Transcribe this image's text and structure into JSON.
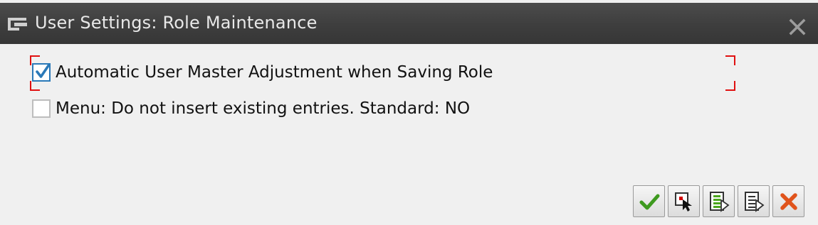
{
  "window": {
    "title": "User Settings: Role Maintenance",
    "icon": "dialog-window-icon",
    "close_icon": "close-icon"
  },
  "options": [
    {
      "label": "Automatic User Master Adjustment when Saving Role",
      "checked": true,
      "focused": true
    },
    {
      "label": "Menu: Do not insert existing entries. Standard: NO",
      "checked": false,
      "focused": false
    }
  ],
  "toolbar": {
    "buttons": [
      {
        "icon": "checkmark-icon",
        "action": "continue"
      },
      {
        "icon": "select-pointer-icon",
        "action": "choose"
      },
      {
        "icon": "select-all-icon",
        "action": "select-all"
      },
      {
        "icon": "deselect-all-icon",
        "action": "deselect-all"
      },
      {
        "icon": "cancel-icon",
        "action": "cancel"
      }
    ]
  },
  "colors": {
    "titlebar": "#3e3e3e",
    "background": "#f0f0f0",
    "focus": "#e01010",
    "check": "#2a79b8",
    "confirm": "#3e9a1f",
    "cancel": "#e0531b"
  }
}
